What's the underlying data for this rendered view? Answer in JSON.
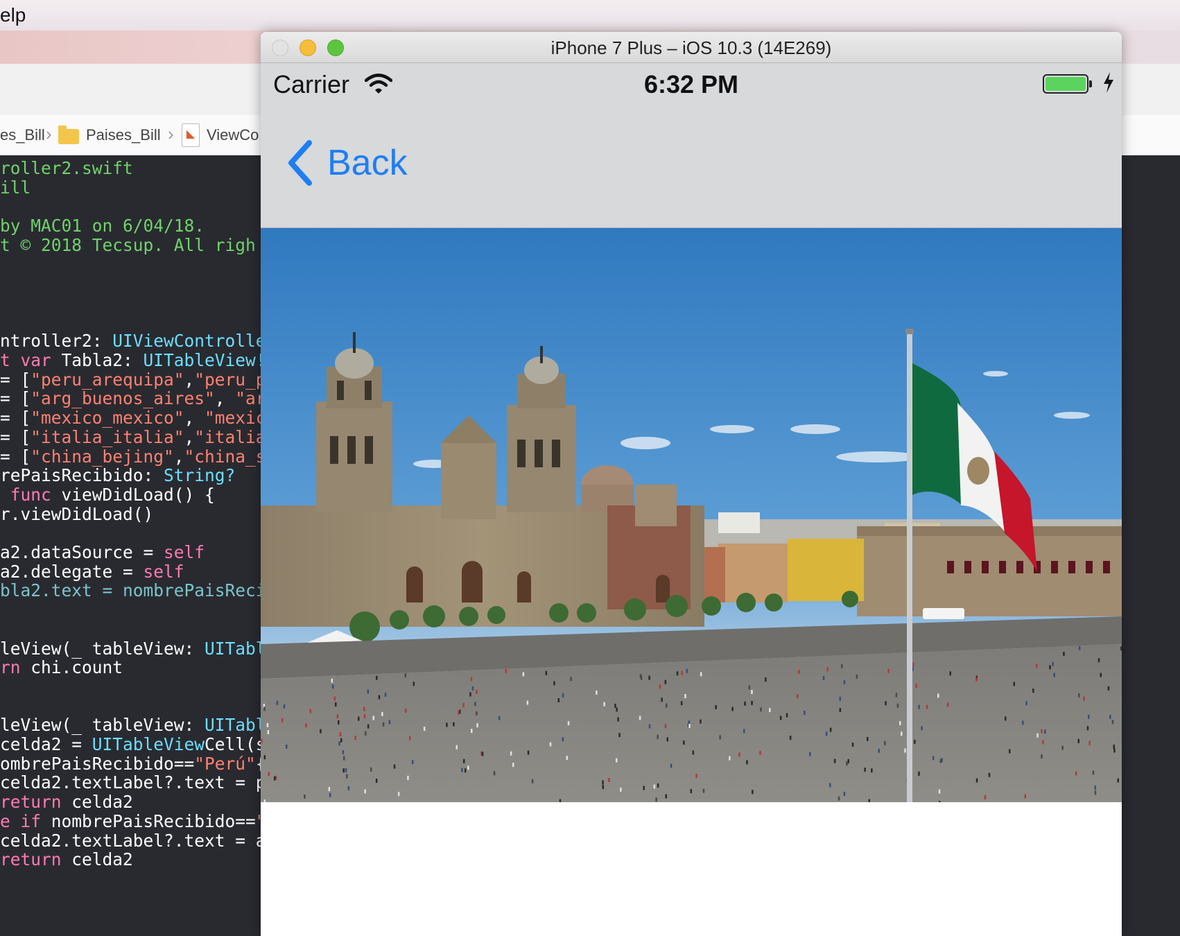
{
  "menubar": {
    "menu_fragment": "elp"
  },
  "xcode": {
    "breadcrumbs": [
      {
        "label": "es_Bill"
      },
      {
        "label": "Paises_Bill"
      },
      {
        "label": "ViewCo"
      }
    ],
    "code_lines": [
      {
        "text": "roller2.swift",
        "kind": "comment"
      },
      {
        "text": "ill",
        "kind": "comment"
      },
      {
        "text": "",
        "kind": "plain"
      },
      {
        "text": "by MAC01 on 6/04/18.",
        "kind": "comment"
      },
      {
        "text": "t © 2018 Tecsup. All righ",
        "kind": "comment"
      },
      {
        "text": "",
        "kind": "plain"
      },
      {
        "text": "",
        "kind": "plain"
      },
      {
        "text": "",
        "kind": "plain"
      },
      {
        "text": "",
        "kind": "plain"
      },
      {
        "text": "ntroller2: UIViewControlle",
        "kind": "mixed-type"
      },
      {
        "text": "t var Tabla2: UITableView!",
        "kind": "mixed-var"
      },
      {
        "text": "= [\"peru_arequipa\",\"peru_p",
        "kind": "array"
      },
      {
        "text": "= [\"arg_buenos_aires\", \"ar",
        "kind": "array"
      },
      {
        "text": "= [\"mexico_mexico\", \"mexic",
        "kind": "array"
      },
      {
        "text": "= [\"italia_italia\",\"italia",
        "kind": "array"
      },
      {
        "text": "= [\"china_bejing\",\"china_s",
        "kind": "array"
      },
      {
        "text": "rePaisRecibido: String?",
        "kind": "optional"
      },
      {
        "text": " func viewDidLoad() {",
        "kind": "func"
      },
      {
        "text": "r.viewDidLoad()",
        "kind": "plain"
      },
      {
        "text": "",
        "kind": "plain"
      },
      {
        "text": "a2.dataSource = self",
        "kind": "self"
      },
      {
        "text": "a2.delegate = self",
        "kind": "self"
      },
      {
        "text": "bla2.text = nombrePaisReci",
        "kind": "teal"
      },
      {
        "text": "",
        "kind": "plain"
      },
      {
        "text": "",
        "kind": "plain"
      },
      {
        "text": "leView(_ tableView: UITabl",
        "kind": "tableview"
      },
      {
        "text": "rn chi.count",
        "kind": "return"
      },
      {
        "text": "",
        "kind": "plain"
      },
      {
        "text": "",
        "kind": "plain"
      },
      {
        "text": "leView(_ tableView: UITabl",
        "kind": "tableview"
      },
      {
        "text": "celda2 = UITableViewCell(s",
        "kind": "plain"
      },
      {
        "text": "ombrePaisRecibido==\"Perú\"{",
        "kind": "compare"
      },
      {
        "text": "celda2.textLabel?.text = p",
        "kind": "plain"
      },
      {
        "text": "return celda2",
        "kind": "return"
      },
      {
        "text": "e if nombrePaisRecibido==\"",
        "kind": "elseif"
      },
      {
        "text": "celda2.textLabel?.text = a",
        "kind": "plain"
      },
      {
        "text": "return celda2",
        "kind": "return"
      }
    ]
  },
  "simulator": {
    "window_title": "iPhone 7 Plus – iOS 10.3 (14E269)",
    "status_bar": {
      "carrier": "Carrier",
      "time": "6:32 PM",
      "battery_level": 1.0,
      "charging": true
    },
    "nav": {
      "back_label": "Back",
      "tint_color": "#1e7ef5"
    },
    "image": {
      "subject": "Zócalo with Metropolitan Cathedral and Mexican flag"
    }
  },
  "colors": {
    "battery_green": "#5bd35e",
    "flag_green": "#0f6b3f",
    "flag_white": "#f2f2f2",
    "flag_red": "#c5162b"
  }
}
